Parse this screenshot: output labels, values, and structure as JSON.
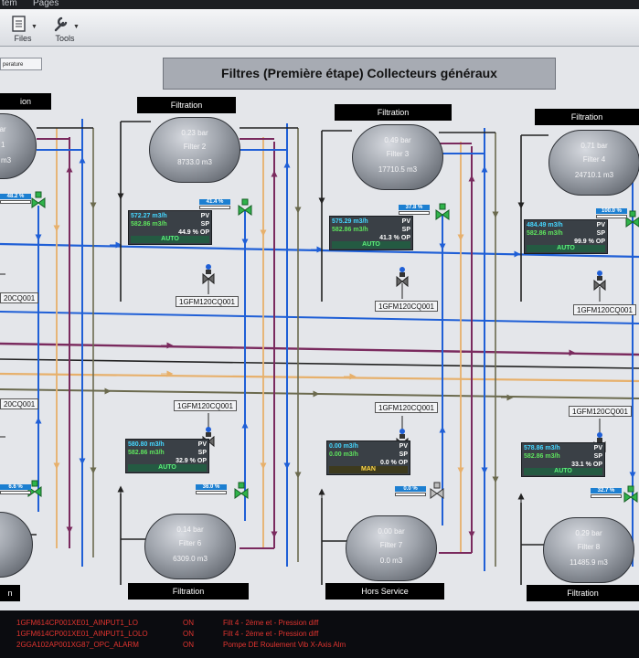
{
  "window": {
    "menu": [
      "tem",
      "Pages"
    ]
  },
  "toolbar": {
    "files_label": "Files",
    "tools_label": "Tools"
  },
  "side_tab": {
    "label": "perature"
  },
  "title": "Filtres (Première étape) Collecteurs généraux",
  "colors": {
    "pipe_blue": "#1f5fd6",
    "pipe_purple": "#7a2a5e",
    "pipe_orange": "#e7b06b",
    "pipe_black": "#222222",
    "pipe_olive": "#6b6a4e",
    "valve_green": "#2fb34a",
    "alarm_red": "#e0342f"
  },
  "top_units": [
    {
      "label": "ion",
      "pressure": "bar",
      "name": "1",
      "volume": "m3",
      "valve_pct": "48.2 %",
      "tag": "20CQ001"
    },
    {
      "label": "Filtration",
      "pressure": "0.23 bar",
      "name": "Filter 2",
      "volume": "8733.0 m3",
      "pv": "572.27 m3/h",
      "sp": "582.86 m3/h",
      "op": "44.9 %",
      "mode": "AUTO",
      "valve_pct": "41.4 %",
      "tag": "1GFM120CQ001"
    },
    {
      "label": "Filtration",
      "pressure": "0.49 bar",
      "name": "Filter 3",
      "volume": "17710.5 m3",
      "pv": "575.29 m3/h",
      "sp": "582.86 m3/h",
      "op": "41.3 %",
      "mode": "AUTO",
      "valve_pct": "37.8 %",
      "tag": "1GFM120CQ001"
    },
    {
      "label": "Filtration",
      "pressure": "0.71 bar",
      "name": "Filter 4",
      "volume": "24710.1 m3",
      "pv": "484.49 m3/h",
      "sp": "582.86 m3/h",
      "op": "99.9 %",
      "mode": "AUTO",
      "valve_pct": "100.0 %",
      "tag": "1GFM120CQ001"
    }
  ],
  "bottom_units": [
    {
      "label": "n",
      "valve_pct": "6.6 %",
      "tag": "20CQ001"
    },
    {
      "label": "Filtration",
      "pressure": "0.14 bar",
      "name": "Filter 6",
      "volume": "6309.0 m3",
      "pv": "580.80 m3/h",
      "sp": "582.86 m3/h",
      "op": "32.9 %",
      "mode": "AUTO",
      "valve_pct": "36.0 %",
      "tag": "1GFM120CQ001"
    },
    {
      "label": "Hors Service",
      "pressure": "0.00 bar",
      "name": "Filter 7",
      "volume": "0.0 m3",
      "pv": "0.00 m3/h",
      "sp": "0.00 m3/h",
      "op": "0.0 %",
      "mode": "MAN",
      "valve_pct": "0.0 %",
      "tag": "1GFM120CQ001"
    },
    {
      "label": "Filtration",
      "pressure": "0.29 bar",
      "name": "Filter 8",
      "volume": "11485.9 m3",
      "pv": "578.86 m3/h",
      "sp": "582.86 m3/h",
      "op": "33.1 %",
      "mode": "AUTO",
      "valve_pct": "32.7 %",
      "tag": "1GFM120CQ001"
    }
  ],
  "flow_tags": {
    "pv": "PV",
    "sp": "SP",
    "op": "OP"
  },
  "alarms": [
    {
      "source": "1GFM614CP001XE01_AINPUT1_LO",
      "state": "ON",
      "message": "Filt 4 - 2ème et - Pression diff"
    },
    {
      "source": "1GFM614CP001XE01_AINPUT1_LOLO",
      "state": "ON",
      "message": "Filt 4 - 2ème et - Pression diff"
    },
    {
      "source": "2GGA102AP001XG87_OPC_ALARM",
      "state": "ON",
      "message": "Pompe DE Roulement Vib X-Axis Alm"
    }
  ]
}
